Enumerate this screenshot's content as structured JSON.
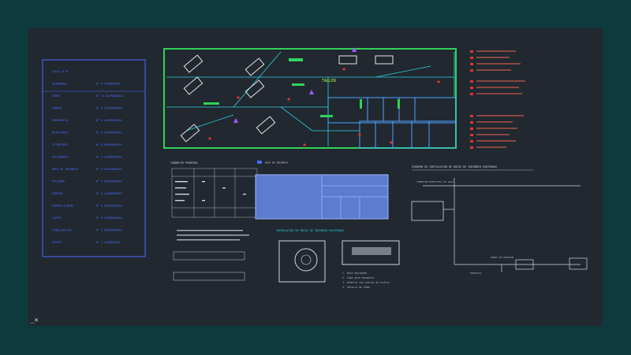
{
  "drawing": {
    "plan": {
      "room_label": "TALLER"
    },
    "left_table": {
      "rows": [
        {
          "label": "CALLE ALTA",
          "value": ""
        },
        {
          "label": "ALUMBRADO",
          "value": "N° 8 LUMINARIAS"
        },
        {
          "label": "TOMAS",
          "value": "N° 12 ALUMINARIAS"
        },
        {
          "label": "CAMBIO",
          "value": "N° 8 ALUMINARIAS"
        },
        {
          "label": "EMERGENCIA",
          "value": "N° 8 ALUMINARIAS"
        },
        {
          "label": "DETECTORES",
          "value": "N° 6 ALUMINARIAS"
        },
        {
          "label": "EXTINTORES",
          "value": "N° 4 ALUMINARIAS"
        },
        {
          "label": "ROCIADORES",
          "value": "N° 3 ALUMINARIAS"
        },
        {
          "label": "BOCA DE INCENDIO",
          "value": "N° 1 ALUMINARIAS"
        },
        {
          "label": "PULSADOR",
          "value": "N° 9 ALUMINARIAS"
        },
        {
          "label": "CENTRAL",
          "value": "N° 2 ALUMINARIAS"
        },
        {
          "label": "SIRENA ALARMA",
          "value": "N° 6 ALUMINARIAS"
        },
        {
          "label": "CARTEL",
          "value": "N° 4 ALUMINARIAS"
        },
        {
          "label": "SEÑALIZACION",
          "value": "N° 3 ALUMINARIAS"
        },
        {
          "label": "ESCAPE",
          "value": "N° 1 LUMINARIAS"
        }
      ]
    },
    "center_titles": {
      "cuadro": "CUADRO DE PERDIDAS",
      "legend_chip": "BOCA DE INCENDIO",
      "instalacion": "INSTALACION DE BOCAS DE INCENDIO EQUIPADAS",
      "esquema": "ESQUEMA DE INSTALACION DE BOCAS DE INCENDIO EQUIPADAS",
      "conexion": "CONEXION MUNICIPAL DE AGUA",
      "grupo_presion": "GRUPO DE PRESION",
      "deposito": "DEPOSITO"
    },
    "notes": [
      "1. Boca equipada",
      "2. Tapa para manguera",
      "3. Armario con puerta de vidrio",
      "4. Valvula de 25mm"
    ]
  },
  "ui": {
    "ucs_icon": "ucs-axis-icon"
  }
}
